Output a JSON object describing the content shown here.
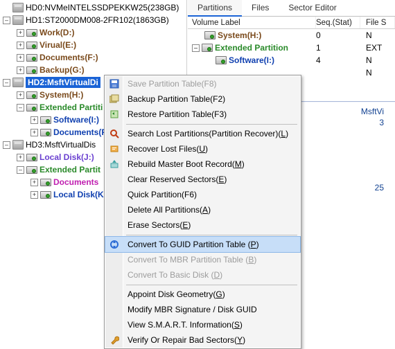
{
  "tree": {
    "hd0": "HD0:NVMeINTELSSDPEKKW25(238GB)",
    "hd1": "HD1:ST2000DM008-2FR102(1863GB)",
    "hd1_workd": "Work(D:)",
    "hd1_virtuale": "Virual(E:)",
    "hd1_docsf": "Documents(F:)",
    "hd1_backupg": "Backup(G:)",
    "hd2": "HD2:MsftVirtualDi",
    "hd2_systemh": "System(H:)",
    "hd2_ext": "Extended Partiti",
    "hd2_softi": "Software(I:)",
    "hd2_docsf": "Documents(F",
    "hd3": "HD3:MsftVirtualDis",
    "hd3_localj": "Local Disk(J:)",
    "hd3_ext": "Extended Partit",
    "hd3_docs": "Documents",
    "hd3_localk": "Local Disk(K"
  },
  "tabs": {
    "partitions": "Partitions",
    "files": "Files",
    "sector": "Sector Editor"
  },
  "grid": {
    "h_label": "Volume Label",
    "h_seq": "Seq.(Stat)",
    "h_file": "File S",
    "r0": {
      "label": "System(H:)",
      "seq": "0",
      "file": "N"
    },
    "r1": {
      "label": "Extended Partition",
      "seq": "1",
      "file": "EXT"
    },
    "r2": {
      "label": "Software(I:)",
      "seq": "4",
      "file": "N"
    },
    "r3": {
      "label": "",
      "seq": "",
      "file": "N"
    }
  },
  "detail": {
    "disk": "MsftVi",
    "se": "3",
    "cap": "25"
  },
  "menu": {
    "save": "Save Partition Table(F8)",
    "backup": "Backup Partition Table(F2)",
    "restore": "Restore Partition Table(F3)",
    "search_pre": "Search Lost Partitions(Partition Recover)(",
    "search_key": "L",
    "search_post": ")",
    "recover_pre": "Recover Lost Files(",
    "recover_key": "U",
    "recover_post": ")",
    "rebuild_pre": "Rebuild Master Boot Record(",
    "rebuild_key": "M",
    "rebuild_post": ")",
    "clear_pre": "Clear Reserved Sectors(",
    "clear_key": "E",
    "clear_post": ")",
    "quick": "Quick Partition(F6)",
    "delall_pre": "Delete All Partitions(",
    "delall_key": "A",
    "delall_post": ")",
    "erase_pre": "Erase Sectors(",
    "erase_key": "E",
    "erase_post": ")",
    "toguid_pre": "Convert To GUID Partition Table (",
    "toguid_key": "P",
    "toguid_post": ")",
    "tombr_pre": "Convert To MBR Partition Table (",
    "tombr_key": "B",
    "tombr_post": ")",
    "tobasic_pre": "Convert To Basic Disk (",
    "tobasic_key": "D",
    "tobasic_post": ")",
    "geom_pre": "Appoint Disk Geometry(",
    "geom_key": "G",
    "geom_post": ")",
    "modsig": "Modify MBR Signature / Disk GUID",
    "smart_pre": "View S.M.A.R.T. Information(",
    "smart_key": "S",
    "smart_post": ")",
    "verify_pre": "Verify Or Repair Bad Sectors(",
    "verify_key": "Y",
    "verify_post": ")"
  }
}
